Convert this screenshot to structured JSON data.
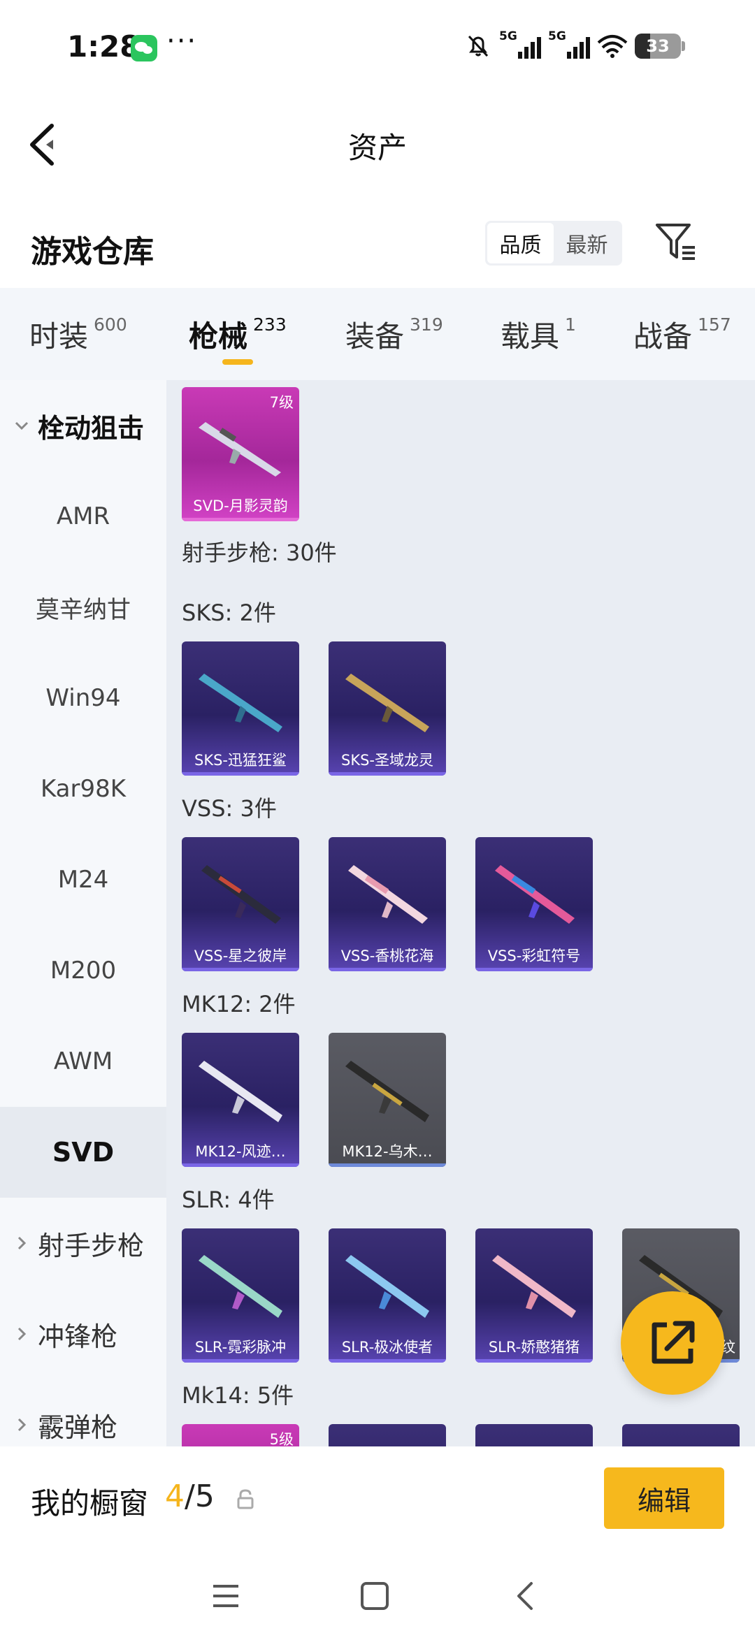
{
  "status": {
    "time": "1:28",
    "more": "···",
    "net1": "5G",
    "net2": "5G",
    "battery": "33"
  },
  "header": {
    "title": "资产"
  },
  "warehouse": {
    "title": "游戏仓库",
    "sort_quality": "品质",
    "sort_newest": "最新"
  },
  "tabs": [
    {
      "label": "时装",
      "count": "600"
    },
    {
      "label": "枪械",
      "count": "233"
    },
    {
      "label": "装备",
      "count": "319"
    },
    {
      "label": "载具",
      "count": "1"
    },
    {
      "label": "战备",
      "count": "157"
    }
  ],
  "sidebar": {
    "group1": "栓动狙击",
    "items": [
      "AMR",
      "莫辛纳甘",
      "Win94",
      "Kar98K",
      "M24",
      "M200",
      "AWM",
      "SVD"
    ],
    "group2": "射手步枪",
    "group3": "冲锋枪",
    "group4": "霰弹枪"
  },
  "content": {
    "svd_card": {
      "name": "SVD-月影灵韵",
      "level": "7级"
    },
    "dmr_summary": "射手步枪: 30件",
    "sks_label": "SKS: 2件",
    "sks": [
      "SKS-迅猛狂鲨",
      "SKS-圣域龙灵"
    ],
    "vss_label": "VSS: 3件",
    "vss": [
      "VSS-星之彼岸",
      "VSS-香桃花海",
      "VSS-彩虹符号"
    ],
    "mk12_label": "MK12: 2件",
    "mk12": [
      "MK12-风迹…",
      "MK12-乌木…"
    ],
    "slr_label": "SLR: 4件",
    "slr": [
      "SLR-霓彩脉冲",
      "SLR-极冰使者",
      "SLR-娇憨猪猪",
      "纹"
    ],
    "mk14_label": "Mk14: 5件",
    "mk14_level": "5级"
  },
  "bottom": {
    "title": "我的橱窗",
    "current": "4",
    "total": "/5",
    "edit": "编辑"
  }
}
